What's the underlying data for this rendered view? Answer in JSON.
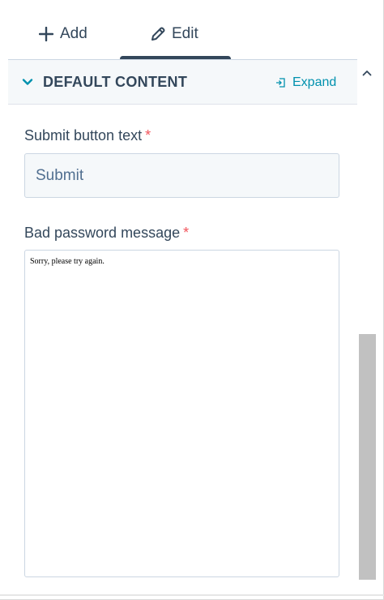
{
  "tabs": {
    "add": {
      "label": "Add",
      "icon": "plus-icon"
    },
    "edit": {
      "label": "Edit",
      "icon": "pencil-icon"
    },
    "active": "edit"
  },
  "section": {
    "title": "DEFAULT CONTENT",
    "expand_label": "Expand"
  },
  "fields": {
    "submit_button_text": {
      "label": "Submit button text",
      "required_mark": "*",
      "value": "Submit"
    },
    "bad_password_message": {
      "label": "Bad password message",
      "required_mark": "*",
      "value": "Sorry, please try again."
    }
  },
  "colors": {
    "text": "#33475b",
    "accent": "#0091ae",
    "required": "#f2545b",
    "input_bg": "#f5f8fa",
    "border": "#cbd6e2"
  }
}
